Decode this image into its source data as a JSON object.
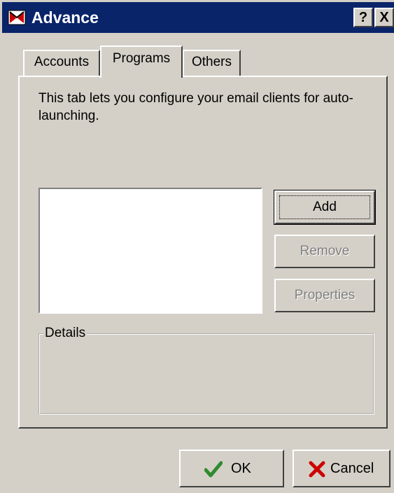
{
  "window": {
    "title": "Advance",
    "help_label": "?",
    "close_label": "X",
    "icon": "app-icon"
  },
  "tabs": [
    {
      "label": "Accounts",
      "selected": false
    },
    {
      "label": "Programs",
      "selected": true
    },
    {
      "label": "Others",
      "selected": false
    }
  ],
  "programs_tab": {
    "description": "This tab lets you configure your email clients for auto-launching.",
    "program_list_items": [],
    "buttons": {
      "add": "Add",
      "remove": "Remove",
      "properties": "Properties"
    },
    "details_label": "Details"
  },
  "footer": {
    "ok": {
      "label": "OK",
      "icon": "checkmark-icon"
    },
    "cancel": {
      "label": "Cancel",
      "icon": "x-icon"
    }
  },
  "colors": {
    "titlebar": "#0a246a",
    "face": "#d4d0c8",
    "ok_icon": "#2e8b2e",
    "cancel_icon": "#cc0000"
  }
}
